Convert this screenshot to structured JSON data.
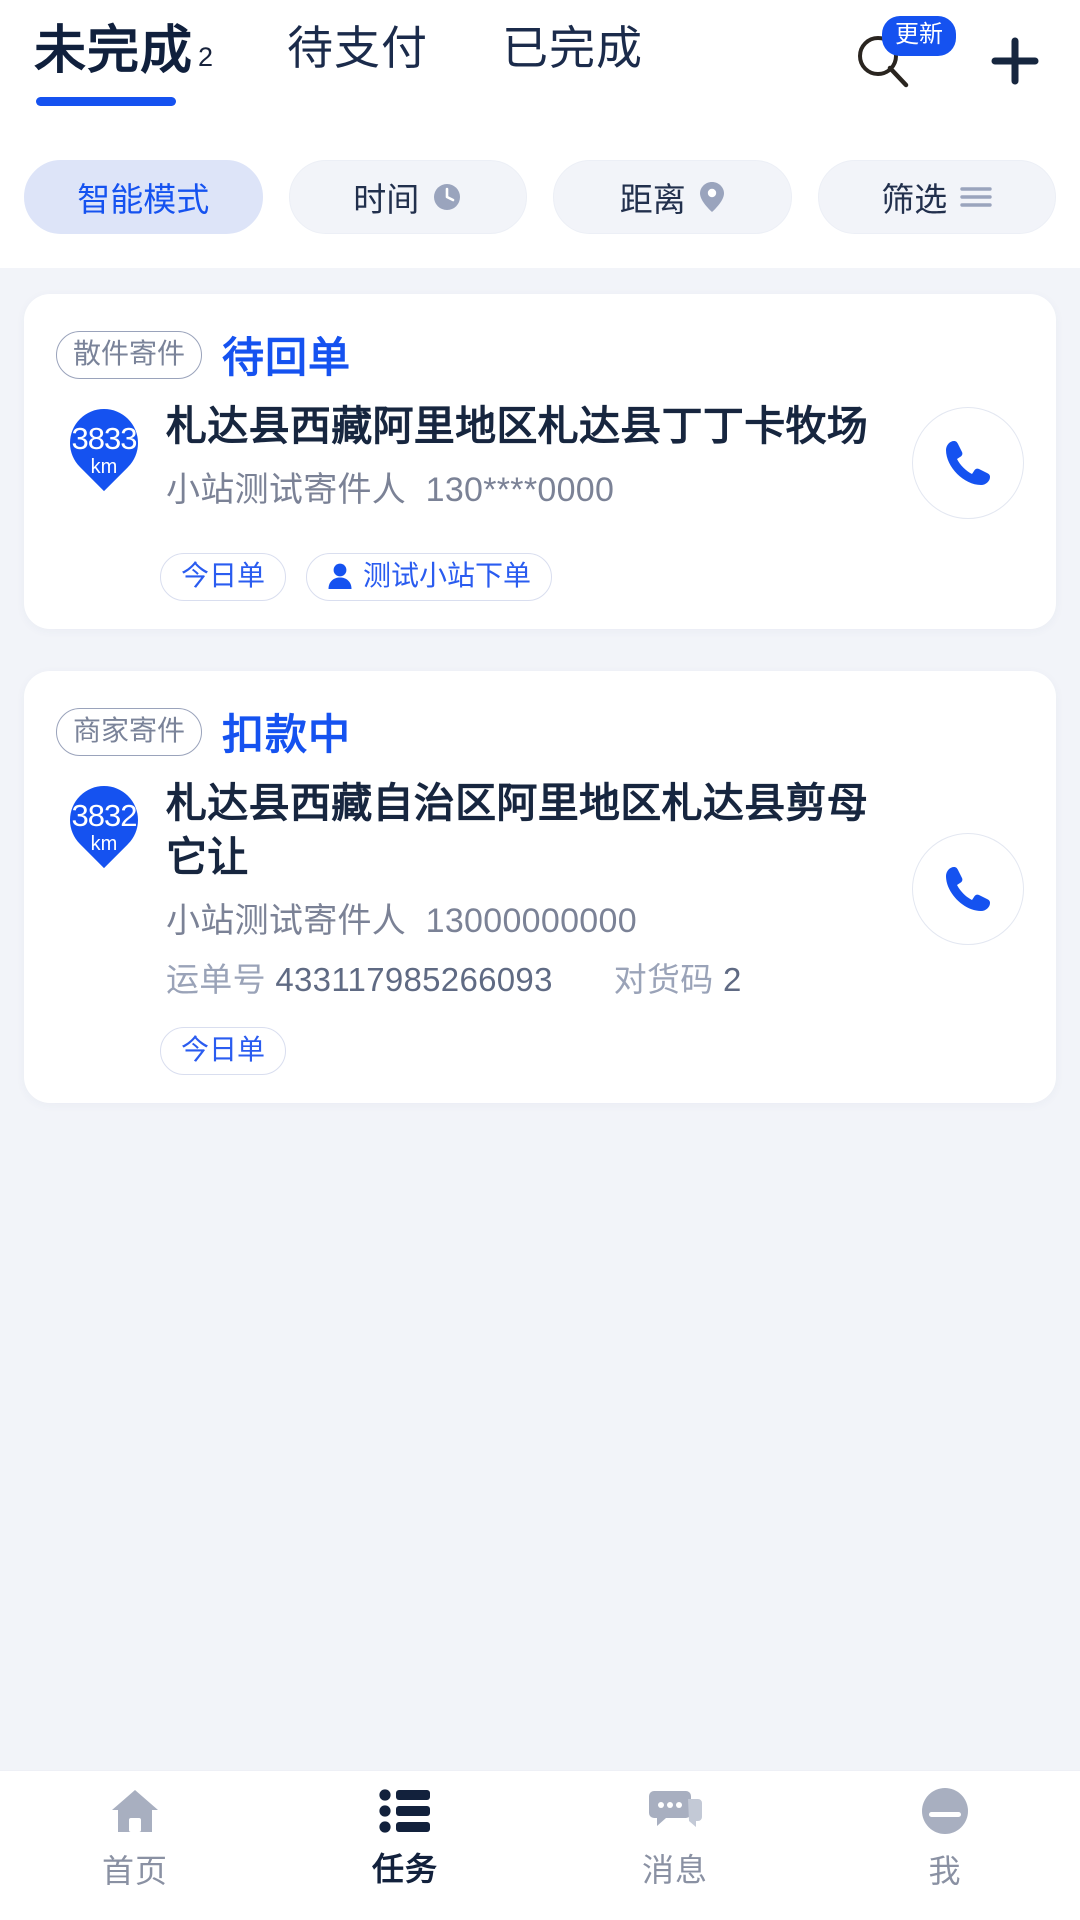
{
  "header": {
    "tabs": [
      {
        "label": "未完成",
        "count": "2",
        "active": true
      },
      {
        "label": "待支付",
        "count": "",
        "active": false
      },
      {
        "label": "已完成",
        "count": "",
        "active": false
      }
    ],
    "search_icon": "search-icon",
    "update_badge": "更新",
    "add_icon": "plus-icon"
  },
  "filters": [
    {
      "label": "智能模式",
      "icon": "",
      "active": true
    },
    {
      "label": "时间",
      "icon": "clock-icon",
      "active": false
    },
    {
      "label": "距离",
      "icon": "location-pin-icon",
      "active": false
    },
    {
      "label": "筛选",
      "icon": "filter-lines-icon",
      "active": false
    }
  ],
  "cards": [
    {
      "type_tag": "散件寄件",
      "status": "待回单",
      "distance": "3833",
      "distance_unit": "km",
      "address": "札达县西藏阿里地区札达县丁丁卡牧场",
      "sender_name": "小站测试寄件人",
      "sender_phone": "130****0000",
      "waybill_label": "",
      "waybill_value": "",
      "match_label": "",
      "match_value": "",
      "tags": [
        {
          "label": "今日单",
          "icon": ""
        },
        {
          "label": "测试小站下单",
          "icon": "person-icon"
        }
      ],
      "call_icon": "phone-icon"
    },
    {
      "type_tag": "商家寄件",
      "status": "扣款中",
      "distance": "3832",
      "distance_unit": "km",
      "address": "札达县西藏自治区阿里地区札达县剪母它让",
      "sender_name": "小站测试寄件人",
      "sender_phone": "13000000000",
      "waybill_label": "运单号",
      "waybill_value": "433117985266093",
      "match_label": "对货码",
      "match_value": "2",
      "tags": [
        {
          "label": "今日单",
          "icon": ""
        }
      ],
      "call_icon": "phone-icon"
    }
  ],
  "bottom_nav": [
    {
      "label": "首页",
      "icon": "home-icon",
      "active": false
    },
    {
      "label": "任务",
      "icon": "list-icon",
      "active": true
    },
    {
      "label": "消息",
      "icon": "chat-icon",
      "active": false
    },
    {
      "label": "我",
      "icon": "profile-icon",
      "active": false
    }
  ],
  "colors": {
    "accent": "#1552f0",
    "title": "#17263f",
    "muted": "#7b8296",
    "page_bg": "#f2f4f9"
  }
}
